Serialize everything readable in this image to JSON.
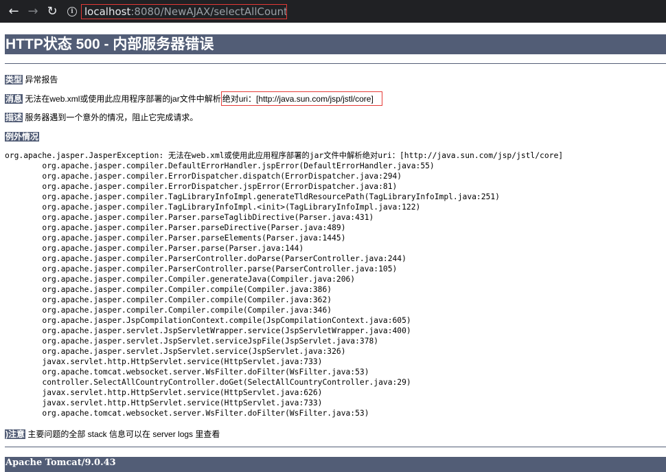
{
  "browser": {
    "url_host": "localhost",
    "url_rest": ":8080/NewAJAX/selectAllCountry",
    "back_icon": "←",
    "forward_icon": "→",
    "reload_icon": "↻",
    "info_icon": "i"
  },
  "page": {
    "title": "HTTP状态 500 - 内部服务器错误",
    "type_label": "类型",
    "type_value": "异常报告",
    "message_label": "消息",
    "message_prefix": "无法在web.xml或使用此应用程序部署的jar文件中解析",
    "message_highlight": "绝对uri：[http://java.sun.com/jsp/jstl/core]",
    "description_label": "描述",
    "description_value": "服务器遇到一个意外的情况，阻止它完成请求。",
    "exception_label": "例外情况",
    "stack_trace": [
      "org.apache.jasper.JasperException: 无法在web.xml或使用此应用程序部署的jar文件中解析绝对uri：[http://java.sun.com/jsp/jstl/core]",
      "\torg.apache.jasper.compiler.DefaultErrorHandler.jspError(DefaultErrorHandler.java:55)",
      "\torg.apache.jasper.compiler.ErrorDispatcher.dispatch(ErrorDispatcher.java:294)",
      "\torg.apache.jasper.compiler.ErrorDispatcher.jspError(ErrorDispatcher.java:81)",
      "\torg.apache.jasper.compiler.TagLibraryInfoImpl.generateTldResourcePath(TagLibraryInfoImpl.java:251)",
      "\torg.apache.jasper.compiler.TagLibraryInfoImpl.<init>(TagLibraryInfoImpl.java:122)",
      "\torg.apache.jasper.compiler.Parser.parseTaglibDirective(Parser.java:431)",
      "\torg.apache.jasper.compiler.Parser.parseDirective(Parser.java:489)",
      "\torg.apache.jasper.compiler.Parser.parseElements(Parser.java:1445)",
      "\torg.apache.jasper.compiler.Parser.parse(Parser.java:144)",
      "\torg.apache.jasper.compiler.ParserController.doParse(ParserController.java:244)",
      "\torg.apache.jasper.compiler.ParserController.parse(ParserController.java:105)",
      "\torg.apache.jasper.compiler.Compiler.generateJava(Compiler.java:206)",
      "\torg.apache.jasper.compiler.Compiler.compile(Compiler.java:386)",
      "\torg.apache.jasper.compiler.Compiler.compile(Compiler.java:362)",
      "\torg.apache.jasper.compiler.Compiler.compile(Compiler.java:346)",
      "\torg.apache.jasper.JspCompilationContext.compile(JspCompilationContext.java:605)",
      "\torg.apache.jasper.servlet.JspServletWrapper.service(JspServletWrapper.java:400)",
      "\torg.apache.jasper.servlet.JspServlet.serviceJspFile(JspServlet.java:378)",
      "\torg.apache.jasper.servlet.JspServlet.service(JspServlet.java:326)",
      "\tjavax.servlet.http.HttpServlet.service(HttpServlet.java:733)",
      "\torg.apache.tomcat.websocket.server.WsFilter.doFilter(WsFilter.java:53)",
      "\tcontroller.SelectAllCountryController.doGet(SelectAllCountryController.java:29)",
      "\tjavax.servlet.http.HttpServlet.service(HttpServlet.java:626)",
      "\tjavax.servlet.http.HttpServlet.service(HttpServlet.java:733)",
      "\torg.apache.tomcat.websocket.server.WsFilter.doFilter(WsFilter.java:53)"
    ],
    "note_label": ")注意",
    "note_value": "主要问题的全部 stack 信息可以在 server logs 里查看",
    "footer": "Apache Tomcat/9.0.43"
  },
  "colors": {
    "header_bg": "#525d76",
    "highlight_border": "#e53935",
    "browser_bg": "#202124"
  }
}
